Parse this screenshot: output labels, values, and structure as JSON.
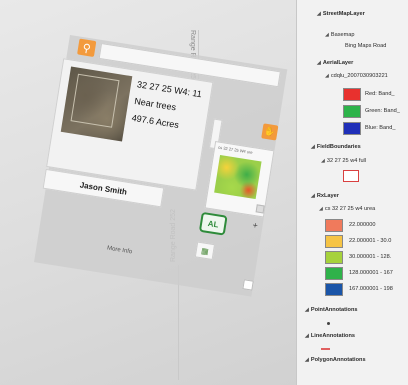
{
  "map": {
    "road_label": "Range Road 252"
  },
  "popup": {
    "field_info": {
      "legal_desc": "32 27 25 W4: 11",
      "note": "Near trees",
      "acres": "497.6 Acres"
    },
    "owner_name": "Jason Smith",
    "more_info_label": "More Info",
    "rx_title": "cs 32 27 25 W4 ure",
    "al_badge": "AL"
  },
  "legend": {
    "layers": [
      {
        "name": "StreetMapLayer"
      },
      {
        "name": "Basemap"
      },
      {
        "name": "Bing Maps Road"
      },
      {
        "name": "AerialLayer"
      },
      {
        "name": "cdqlu_2007030903221"
      },
      {
        "name": "FieldBoundaries"
      },
      {
        "name": "32 27 25 w4 full"
      },
      {
        "name": "RxLayer"
      },
      {
        "name": "cs 32 27 25 w4 urea"
      },
      {
        "name": "PointAnnotations"
      },
      {
        "name": "LineAnnotations"
      },
      {
        "name": "PolygonAnnotations"
      }
    ],
    "bands": [
      {
        "label": "Red:  Band_",
        "color": "#e8312e"
      },
      {
        "label": "Green: Band_",
        "color": "#2db34a"
      },
      {
        "label": "Blue:  Band_",
        "color": "#1f2fb8"
      }
    ],
    "rx_classes": [
      {
        "label": "22.000000",
        "color": "#f07a5c"
      },
      {
        "label": "22.000001 - 30.0",
        "color": "#f6c445"
      },
      {
        "label": "30.000001 - 128.",
        "color": "#a6d23c"
      },
      {
        "label": "128.000001 - 167",
        "color": "#2fb24a"
      },
      {
        "label": "167.000001 - 198",
        "color": "#1a55a8"
      }
    ],
    "field_outline_color": "#d94040"
  }
}
